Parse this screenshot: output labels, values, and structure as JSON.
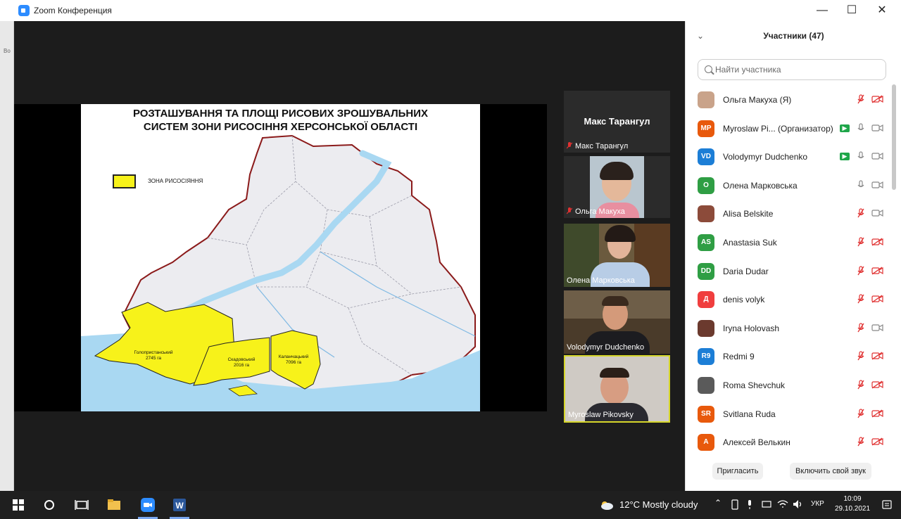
{
  "window": {
    "title": "Zoom Конференция",
    "close_glyph": "✕",
    "max_glyph": "☐",
    "min_glyph": "—"
  },
  "slide": {
    "title_line1": "РОЗТАШУВАННЯ ТА ПЛОЩІ РИСОВИХ ЗРОШУВАЛЬНИХ",
    "title_line2": "СИСТЕМ ЗОНИ РИСОСІННЯ ХЕРСОНСЬКОЇ ОБЛАСТІ",
    "legend_label": "ЗОНА РИСОСІЯННЯ",
    "zones": [
      {
        "name": "Голопристанський",
        "area": "2745 га"
      },
      {
        "name": "Скадовський",
        "area": "2016 га"
      },
      {
        "name": "Каланчацький",
        "area": "7096 га"
      }
    ],
    "colors": {
      "zone": "#f7f21a",
      "border": "#8b1a1a",
      "water": "#a9d8f2",
      "land": "#ececf0"
    }
  },
  "video_tiles": [
    {
      "name": "Макс Тарангул",
      "big_name": "Макс Тарангул",
      "muted": true
    },
    {
      "name": "Ольга Макуха",
      "muted": true
    },
    {
      "name": "Олена Марковська",
      "muted": false
    },
    {
      "name": "Volodymyr Dudchenko",
      "muted": false
    },
    {
      "name": "Myroslaw Pikovsky",
      "muted": false,
      "active_speaker": true
    }
  ],
  "participants_panel": {
    "title": "Участники (47)",
    "search_placeholder": "Найти участника",
    "items": [
      {
        "initials": "",
        "name": "Ольга Макуха (Я)",
        "avatar_color": "#c9a38a",
        "photo": true,
        "mic": "muted",
        "cam": "off"
      },
      {
        "initials": "MP",
        "name": "Myroslaw Pi... (Организатор)",
        "avatar_color": "#e8590c",
        "photo": false,
        "mic": "on",
        "cam": "on",
        "badge": true
      },
      {
        "initials": "VD",
        "name": "Volodymyr Dudchenko",
        "avatar_color": "#1c7ed6",
        "photo": false,
        "mic": "on",
        "cam": "on",
        "badge": true
      },
      {
        "initials": "O",
        "name": "Олена Марковська",
        "avatar_color": "#2f9e44",
        "photo": false,
        "mic": "on",
        "cam": "on"
      },
      {
        "initials": "",
        "name": "Alisa Belskite",
        "avatar_color": "#8c4b3a",
        "photo": true,
        "mic": "muted",
        "cam": "on"
      },
      {
        "initials": "AS",
        "name": "Anastasia Suk",
        "avatar_color": "#2f9e44",
        "photo": false,
        "mic": "muted",
        "cam": "off"
      },
      {
        "initials": "DD",
        "name": "Daria Dudar",
        "avatar_color": "#2f9e44",
        "photo": false,
        "mic": "muted",
        "cam": "off"
      },
      {
        "initials": "Д",
        "name": "denis volyk",
        "avatar_color": "#f03e3e",
        "photo": false,
        "mic": "muted",
        "cam": "off"
      },
      {
        "initials": "",
        "name": "Iryna Holovash",
        "avatar_color": "#6b3a2e",
        "photo": true,
        "mic": "muted",
        "cam": "on"
      },
      {
        "initials": "R9",
        "name": "Redmi 9",
        "avatar_color": "#1c7ed6",
        "photo": false,
        "mic": "muted",
        "cam": "off"
      },
      {
        "initials": "",
        "name": "Roma Shevchuk",
        "avatar_color": "#5a5a5a",
        "photo": true,
        "mic": "muted",
        "cam": "off"
      },
      {
        "initials": "SR",
        "name": "Svitlana Ruda",
        "avatar_color": "#e8590c",
        "photo": false,
        "mic": "muted",
        "cam": "off"
      },
      {
        "initials": "A",
        "name": "Алексей Велькин",
        "avatar_color": "#e8590c",
        "photo": false,
        "mic": "muted",
        "cam": "off"
      }
    ],
    "invite_label": "Пригласить",
    "unmute_label": "Включить свой звук"
  },
  "taskbar": {
    "weather": "12°C  Mostly cloudy",
    "lang": "УКР",
    "time": "10:09",
    "date": "29.10.2021"
  },
  "left_strip_text": "Bo"
}
